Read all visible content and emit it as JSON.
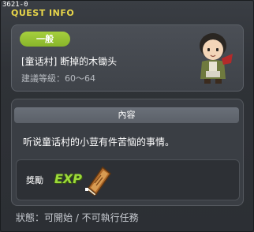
{
  "window": {
    "quest_id": "3621-0",
    "title": "QUEST INFO"
  },
  "quest": {
    "category": "一般",
    "name": "[童话村] 断掉的木锄头",
    "level": "建議等級：60～64",
    "npc_icon": "npc-portrait"
  },
  "content": {
    "header": "內容",
    "description": "听说童话村的小荳有件苦恼的事情。"
  },
  "reward": {
    "label": "獎勵",
    "exp_label": "EXP",
    "item_icon": "book-icon"
  },
  "status": {
    "text": "狀態：可開始 / 不可執行任務"
  },
  "colors": {
    "title": "#e8d64a",
    "badge": "#9cc83a",
    "exp": "#9cd93a"
  }
}
